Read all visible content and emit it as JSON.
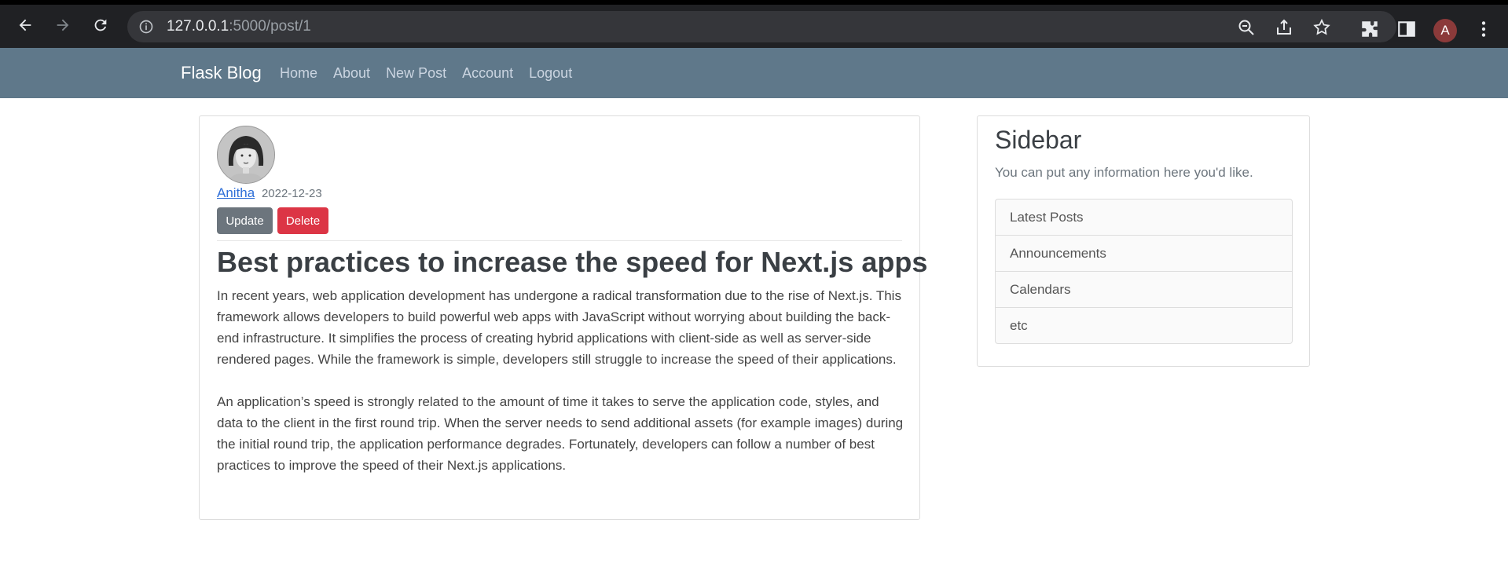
{
  "browser": {
    "url_host": "127.0.0.1",
    "url_path": ":5000/post/1",
    "profile_initial": "A"
  },
  "navbar": {
    "brand": "Flask Blog",
    "links": [
      "Home",
      "About",
      "New Post",
      "Account",
      "Logout"
    ]
  },
  "post": {
    "author": "Anitha",
    "date": "2022-12-23",
    "update_label": "Update",
    "delete_label": "Delete",
    "title": "Best practices to increase the speed for Next.js apps",
    "paragraphs": [
      "In recent years, web application development has undergone a radical transformation due to the rise of Next.js. This framework allows developers to build powerful web apps with JavaScript without worrying about building the back-end infrastructure. It simplifies the process of creating hybrid applications with client-side as well as server-side rendered pages. While the framework is simple, developers still struggle to increase the speed of their applications.",
      "An application’s speed is strongly related to the amount of time it takes to serve the application code, styles, and data to the client in the first round trip. When the server needs to send additional assets (for example images) during the initial round trip, the application performance degrades. Fortunately, developers can follow a number of best practices to improve the speed of their Next.js applications."
    ]
  },
  "sidebar": {
    "title": "Sidebar",
    "description": "You can put any information here you'd like.",
    "items": [
      "Latest Posts",
      "Announcements",
      "Calendars",
      "etc"
    ]
  },
  "colors": {
    "navbar_bg": "#5f788a",
    "update_btn": "#6c757d",
    "delete_btn": "#dc3545",
    "link": "#2f6fd8"
  }
}
